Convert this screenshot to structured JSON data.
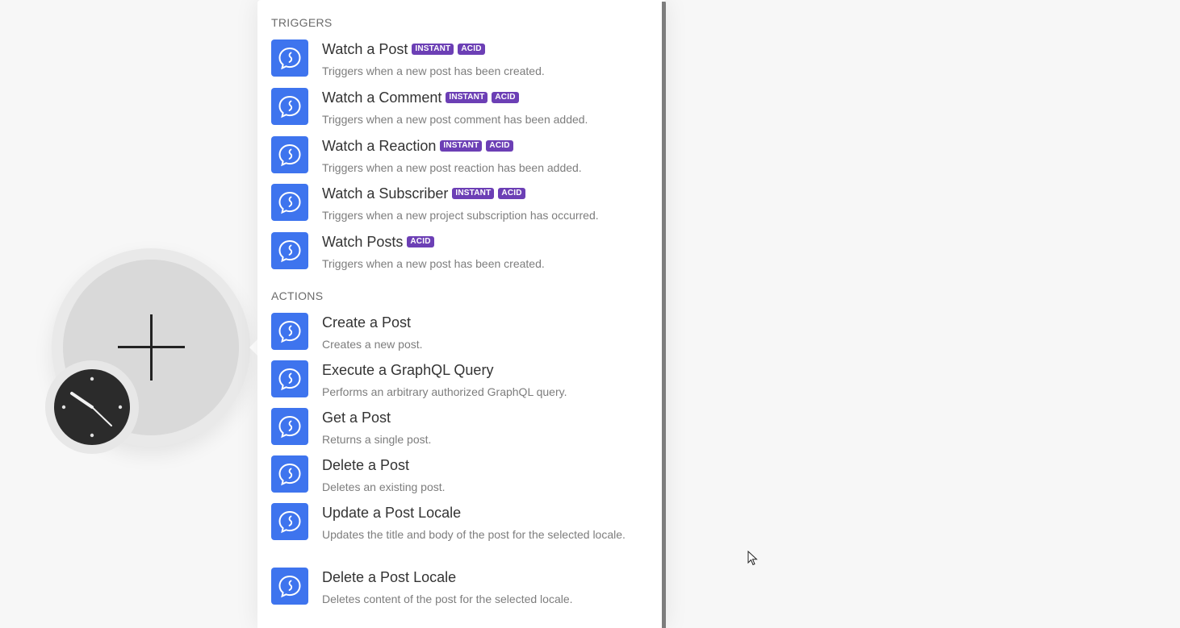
{
  "sections": [
    {
      "title": "TRIGGERS",
      "items": [
        {
          "title": "Watch a Post",
          "badges": [
            "INSTANT",
            "ACID"
          ],
          "desc": "Triggers when a new post has been created."
        },
        {
          "title": "Watch a Comment",
          "badges": [
            "INSTANT",
            "ACID"
          ],
          "desc": "Triggers when a new post comment has been added."
        },
        {
          "title": "Watch a Reaction",
          "badges": [
            "INSTANT",
            "ACID"
          ],
          "desc": "Triggers when a new post reaction has been added."
        },
        {
          "title": "Watch a Subscriber",
          "badges": [
            "INSTANT",
            "ACID"
          ],
          "desc": "Triggers when a new project subscription has occurred."
        },
        {
          "title": "Watch Posts",
          "badges": [
            "ACID"
          ],
          "desc": "Triggers when a new post has been created."
        }
      ]
    },
    {
      "title": "ACTIONS",
      "items": [
        {
          "title": "Create a Post",
          "badges": [],
          "desc": "Creates a new post."
        },
        {
          "title": "Execute a GraphQL Query",
          "badges": [],
          "desc": "Performs an arbitrary authorized GraphQL query."
        },
        {
          "title": "Get a Post",
          "badges": [],
          "desc": "Returns a single post."
        },
        {
          "title": "Delete a Post",
          "badges": [],
          "desc": "Deletes an existing post."
        },
        {
          "title": "Update a Post Locale",
          "badges": [],
          "desc": "Updates the title and body of the post for the selected locale."
        },
        {
          "title": "Delete a Post Locale",
          "badges": [],
          "desc": "Deletes content of the post for the selected locale."
        }
      ]
    }
  ],
  "icons": {
    "app_icon": "speech-bubble-icon",
    "add_icon": "plus-icon",
    "schedule_icon": "clock-icon"
  },
  "colors": {
    "app_icon_bg": "#3e74ee",
    "badge_bg": "#6c3fb5",
    "clock_bg": "#2b2b2b"
  }
}
